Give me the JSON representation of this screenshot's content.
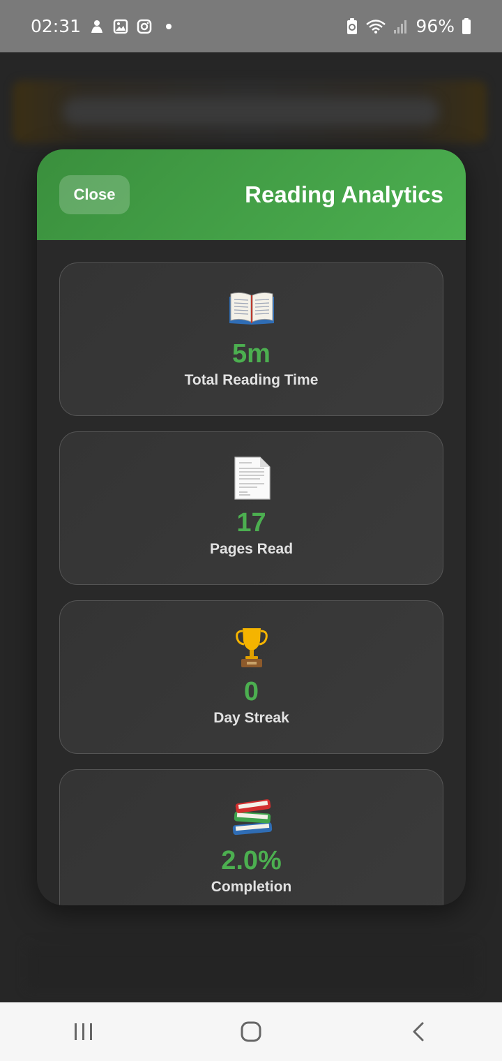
{
  "status_bar": {
    "time": "02:31",
    "battery": "96%",
    "left_icons": [
      "notification-icon",
      "gallery-icon",
      "instagram-icon",
      "dot-icon"
    ],
    "right_icons": [
      "battery-saver-icon",
      "wifi-icon",
      "signal-icon",
      "battery-icon"
    ]
  },
  "modal": {
    "title": "Reading Analytics",
    "close_label": "Close",
    "accent_color": "#4caf50",
    "stats": [
      {
        "icon": "open-book-icon",
        "value": "5m",
        "label": "Total Reading Time"
      },
      {
        "icon": "page-icon",
        "value": "17",
        "label": "Pages Read"
      },
      {
        "icon": "trophy-icon",
        "value": "0",
        "label": "Day Streak"
      },
      {
        "icon": "books-stack-icon",
        "value": "2.0%",
        "label": "Completion"
      }
    ]
  },
  "nav_bar": {
    "buttons": [
      "recents-icon",
      "home-icon",
      "back-icon"
    ]
  }
}
